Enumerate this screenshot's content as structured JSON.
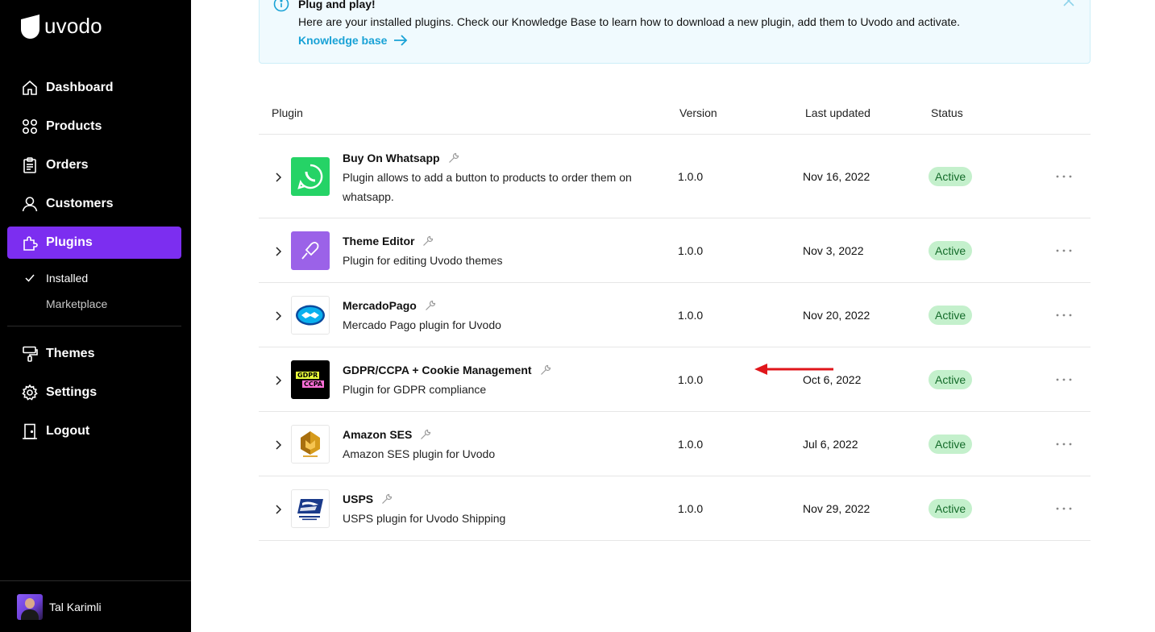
{
  "brand": {
    "name": "uvodo"
  },
  "nav": {
    "items": [
      {
        "label": "Dashboard",
        "icon": "home-icon"
      },
      {
        "label": "Products",
        "icon": "grid-icon"
      },
      {
        "label": "Orders",
        "icon": "clipboard-icon"
      },
      {
        "label": "Customers",
        "icon": "user-icon"
      },
      {
        "label": "Plugins",
        "icon": "puzzle-icon"
      }
    ],
    "sub_items": [
      {
        "label": "Installed"
      },
      {
        "label": "Marketplace"
      }
    ],
    "lower_items": [
      {
        "label": "Themes",
        "icon": "paint-roller-icon"
      },
      {
        "label": "Settings",
        "icon": "gear-icon"
      },
      {
        "label": "Logout",
        "icon": "door-icon"
      }
    ]
  },
  "user": {
    "name": "Tal Karimli"
  },
  "banner": {
    "title": "Plug and play!",
    "text": "Here are your installed plugins. Check our Knowledge Base to learn how to download a new plugin, add them to Uvodo and activate.",
    "link": "Knowledge base"
  },
  "table": {
    "headers": {
      "plugin": "Plugin",
      "version": "Version",
      "updated": "Last updated",
      "status": "Status"
    },
    "rows": [
      {
        "name": "Buy On Whatsapp",
        "desc": "Plugin allows to add a button to products to order them on whatsapp.",
        "version": "1.0.0",
        "updated": "Nov 16, 2022",
        "status": "Active",
        "logo": "whatsapp-logo"
      },
      {
        "name": "Theme Editor",
        "desc": "Plugin for editing Uvodo themes",
        "version": "1.0.0",
        "updated": "Nov 3, 2022",
        "status": "Active",
        "logo": "theme-editor-logo"
      },
      {
        "name": "MercadoPago",
        "desc": "Mercado Pago plugin for Uvodo",
        "version": "1.0.0",
        "updated": "Nov 20, 2022",
        "status": "Active",
        "logo": "mercadopago-logo"
      },
      {
        "name": "GDPR/CCPA + Cookie Management",
        "desc": "Plugin for GDPR compliance",
        "version": "1.0.0",
        "updated": "Oct 6, 2022",
        "status": "Active",
        "logo": "gdpr-logo",
        "logo_text_1": "GDPR",
        "logo_text_2": "CCPA"
      },
      {
        "name": "Amazon SES",
        "desc": "Amazon SES plugin for Uvodo",
        "version": "1.0.0",
        "updated": "Jul 6, 2022",
        "status": "Active",
        "logo": "amazon-ses-logo"
      },
      {
        "name": "USPS",
        "desc": "USPS plugin for Uvodo Shipping",
        "version": "1.0.0",
        "updated": "Nov 29, 2022",
        "status": "Active",
        "logo": "usps-logo"
      }
    ]
  },
  "colors": {
    "accent": "#7c2ef0",
    "link": "#19a2d6",
    "badge_bg": "#c4f0cc",
    "badge_text": "#146b2a",
    "annotation_arrow": "#e0161b"
  }
}
